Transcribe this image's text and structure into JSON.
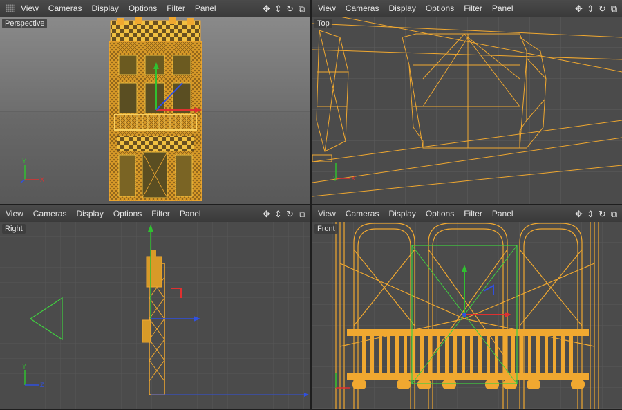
{
  "menus": [
    "View",
    "Cameras",
    "Display",
    "Options",
    "Filter",
    "Panel"
  ],
  "tool_icons": [
    "move-view-icon",
    "dolly-view-icon",
    "rotate-view-icon",
    "maximize-panel-icon"
  ],
  "viewports": {
    "perspective": {
      "label": "Perspective"
    },
    "top": {
      "label": "Top"
    },
    "right": {
      "label": "Right"
    },
    "front": {
      "label": "Front"
    }
  },
  "axes": {
    "x": "X",
    "y": "Y",
    "z": "Z"
  },
  "colors": {
    "wire": "#f0a830",
    "x_axis": "#e03030",
    "y_axis": "#30c030",
    "z_axis": "#3050e0",
    "camera": "#40d040",
    "viewport_bg": "#4b4b4b",
    "grid": "#5a5a5a"
  }
}
